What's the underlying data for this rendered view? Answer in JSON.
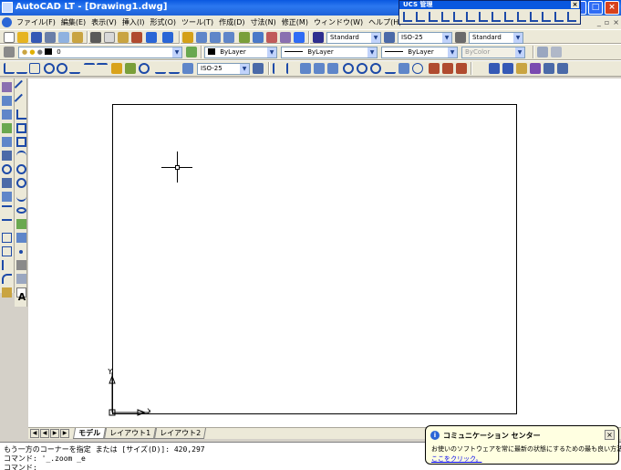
{
  "window": {
    "title": "AutoCAD LT - [Drawing1.dwg]",
    "min_glyph": "_",
    "max_glyph": "□",
    "close_glyph": "×"
  },
  "menubar": {
    "items": [
      "ファイル(F)",
      "編集(E)",
      "表示(V)",
      "挿入(I)",
      "形式(O)",
      "ツール(T)",
      "作成(D)",
      "寸法(N)",
      "修正(M)",
      "ウィンドウ(W)",
      "ヘルプ(H)"
    ],
    "mdi": [
      "_",
      "▫",
      "×"
    ]
  },
  "ucs_panel": {
    "title": "UCS 管理",
    "close_glyph": "×"
  },
  "styles": {
    "text_style": "Standard",
    "dim_style": "ISO-25",
    "table_style": "Standard"
  },
  "layers": {
    "current_layer": "0",
    "color": "ByLayer",
    "linetype": "ByLayer",
    "lineweight": "ByLayer",
    "plotstyle": "ByColor"
  },
  "dim_toolbar": {
    "dim_style": "ISO-25"
  },
  "palette": {
    "text_tool_glyph": "A"
  },
  "canvas": {
    "ucs_y_label": "Y",
    "ucs_x_label": "X"
  },
  "tabs": {
    "nav": [
      "◀",
      "◀",
      "▶",
      "▶"
    ],
    "items": [
      "モデル",
      "レイアウト1",
      "レイアウト2"
    ]
  },
  "command": {
    "lines": [
      "もう一方のコーナーを指定 または [サイズ(D)]: 420,297",
      "コマンド: '_.zoom _e",
      "コマンド:"
    ]
  },
  "balloon": {
    "title": "コミュニケーション センター",
    "message": "お使いのソフトウェアを常に最新の状態にするための最も良い方法です。",
    "link": "ここをクリック。",
    "info_glyph": "i",
    "close_glyph": "×"
  },
  "colors": {
    "titlebar": "#0a58e0",
    "chrome": "#ece9d8",
    "canvas": "#ffffff",
    "balloon": "#ffffe1"
  }
}
